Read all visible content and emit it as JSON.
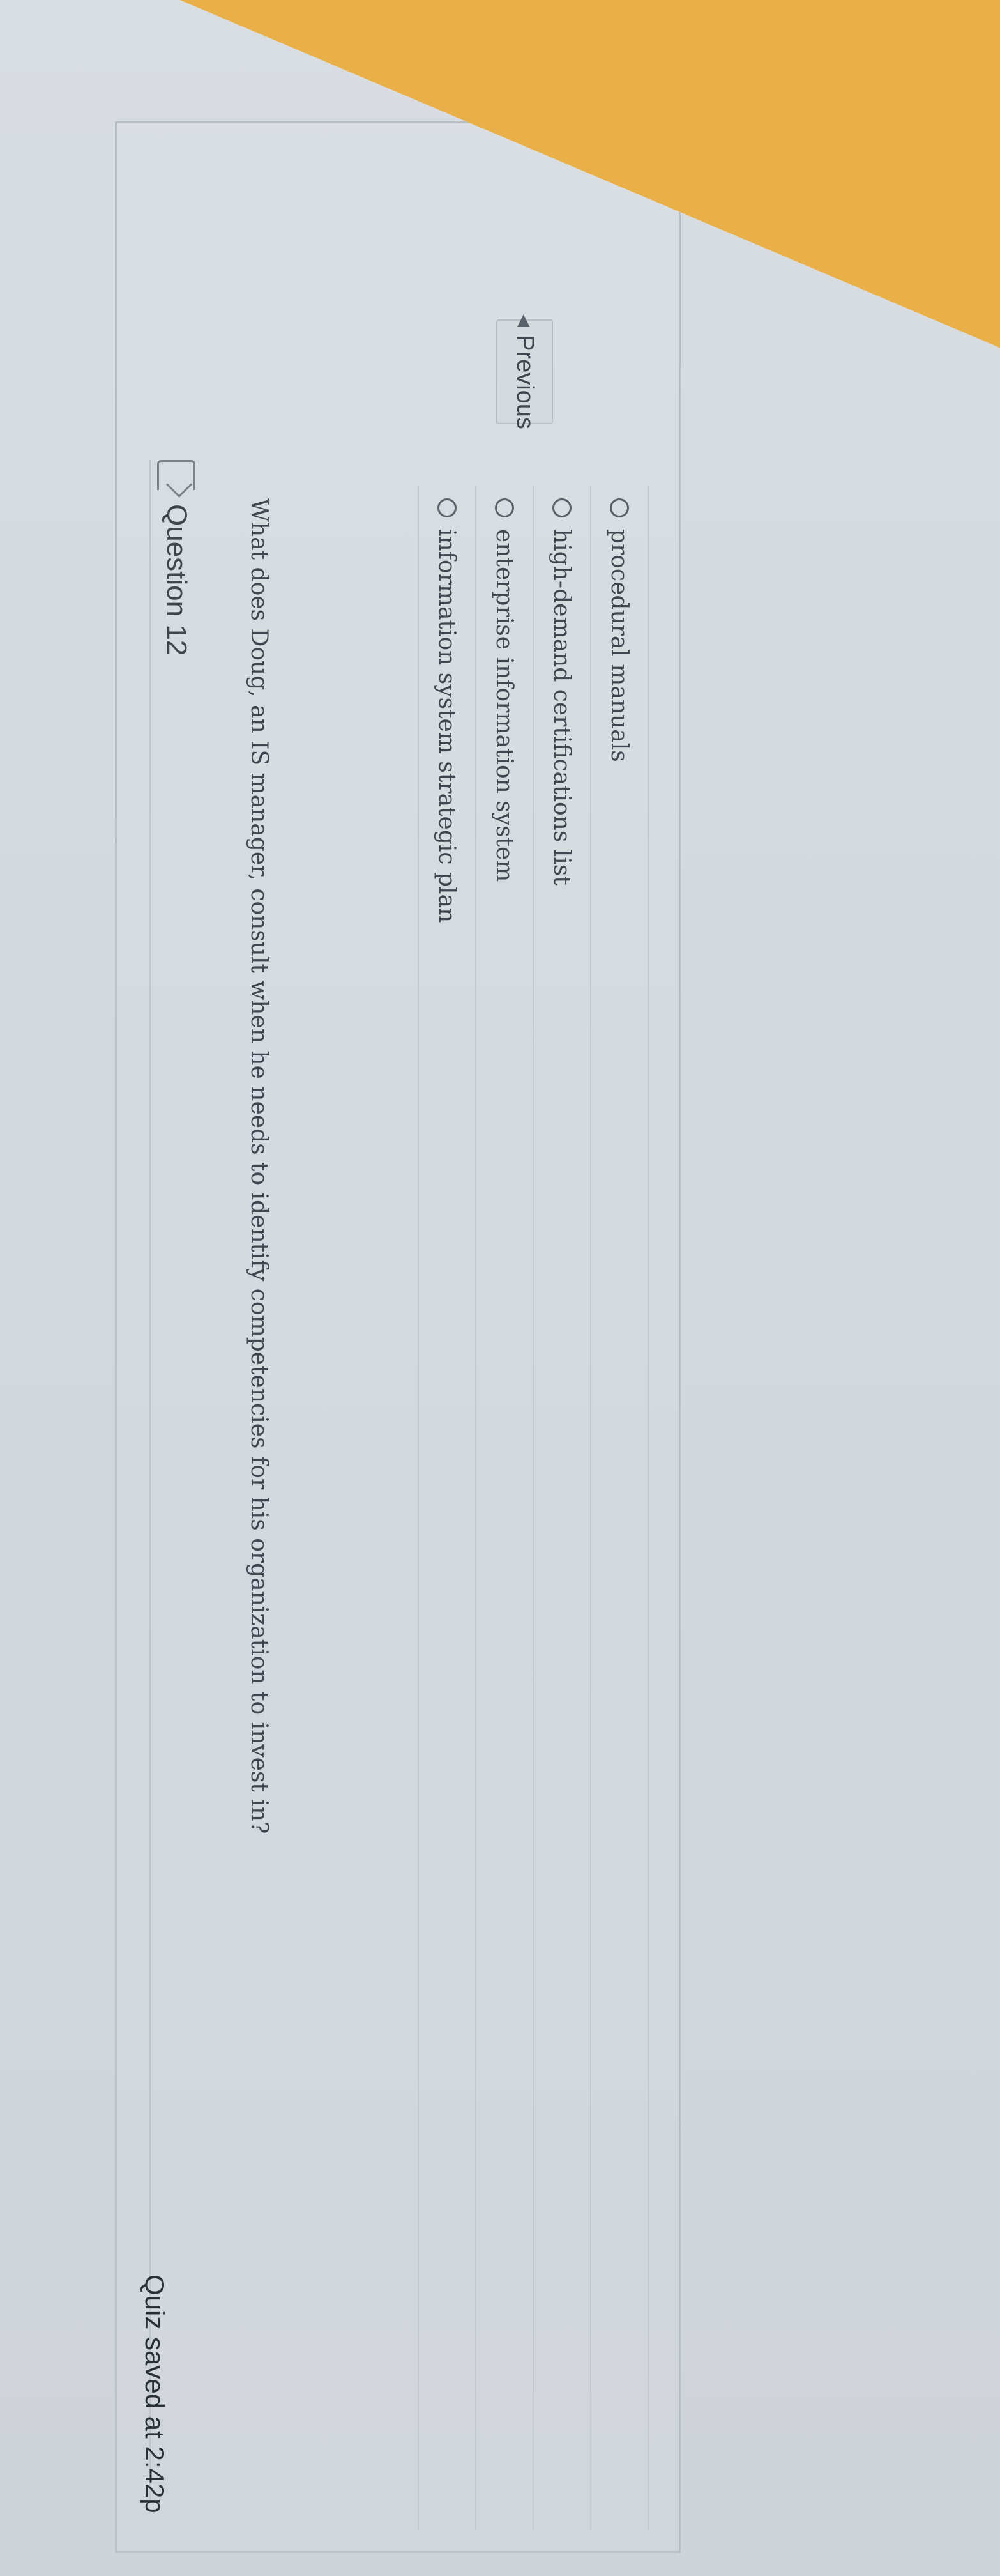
{
  "question": {
    "title": "Question 12",
    "text": "What does Doug, an IS manager, consult when he needs to identify competencies for his organization to invest in?"
  },
  "answers": [
    {
      "label": "procedural manuals"
    },
    {
      "label": "high-demand certifications list"
    },
    {
      "label": "enterprise information system"
    },
    {
      "label": "information system strategic plan"
    }
  ],
  "nav": {
    "previous_label": "Previous"
  },
  "status": {
    "saved_text": "Quiz saved at 2:42p"
  }
}
